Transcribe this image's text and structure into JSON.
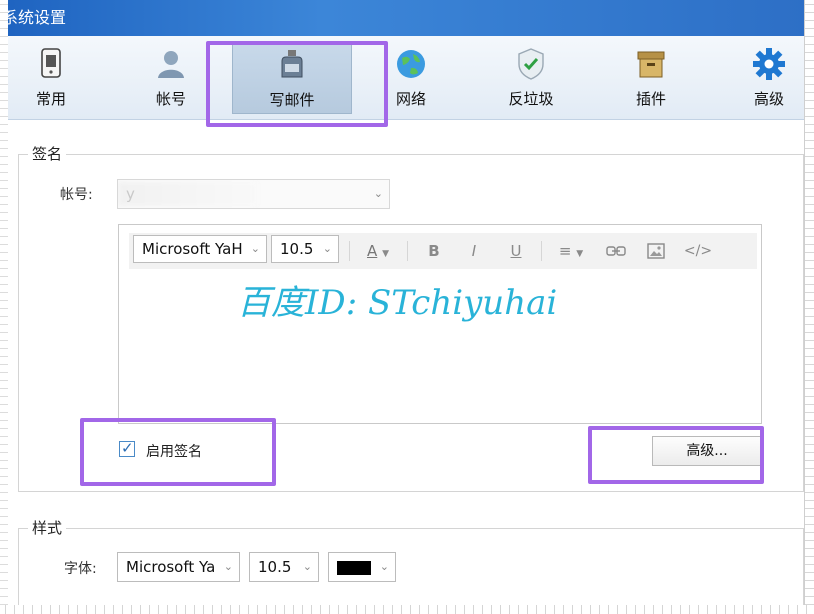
{
  "window": {
    "title": "系统设置"
  },
  "toolbar": {
    "items": [
      {
        "label": "常用",
        "icon": "phone-icon"
      },
      {
        "label": "帐号",
        "icon": "user-icon"
      },
      {
        "label": "写邮件",
        "icon": "ink-bottle-icon"
      },
      {
        "label": "网络",
        "icon": "globe-icon"
      },
      {
        "label": "反垃圾",
        "icon": "shield-icon"
      },
      {
        "label": "插件",
        "icon": "box-icon"
      },
      {
        "label": "高级",
        "icon": "gear-icon"
      }
    ],
    "active": "写邮件"
  },
  "signature": {
    "legend": "签名",
    "account_label": "帐号:",
    "account_value": "y",
    "editor": {
      "font_family": "Microsoft YaH",
      "font_size": "10.5",
      "content": "百度ID: STchiyuhai",
      "content_color": "#29b3d8"
    },
    "enable_label": "启用签名",
    "enable_checked": true,
    "advanced_button": "高级..."
  },
  "style": {
    "legend": "样式",
    "font_label": "字体:",
    "font_family": "Microsoft Ya",
    "font_size": "10.5",
    "color": "#000000"
  },
  "colors": {
    "highlight": "#a267e8",
    "titlebar": "#2d6fc6"
  }
}
